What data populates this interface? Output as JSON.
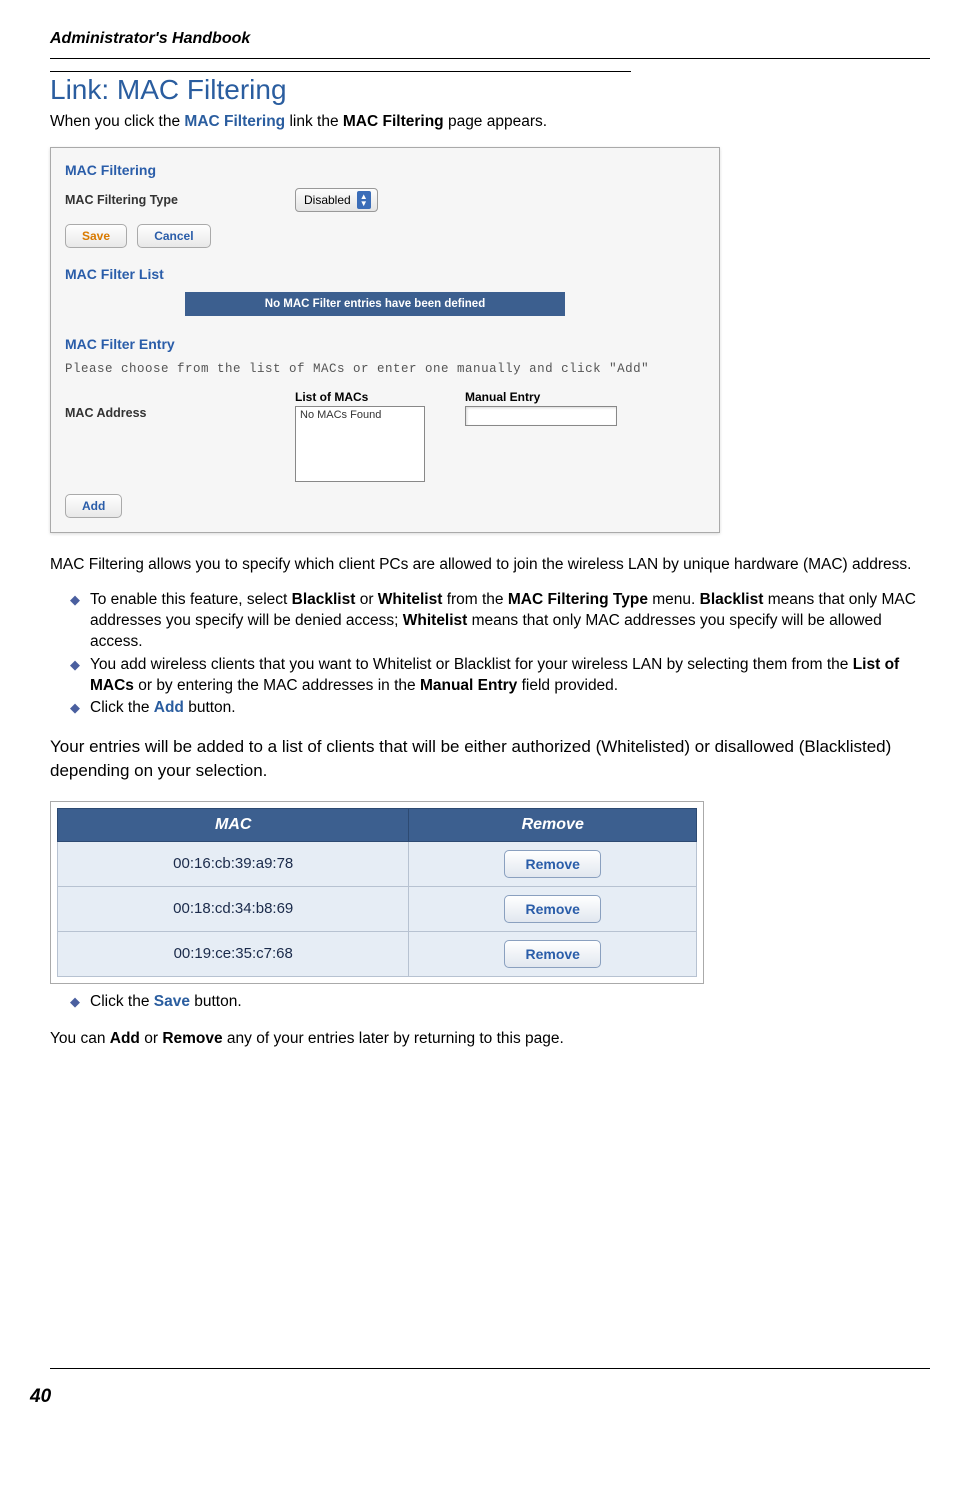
{
  "header": {
    "running": "Administrator's Handbook"
  },
  "section": {
    "title": "Link: MAC Filtering",
    "intro_pre": "When you click the ",
    "intro_link": "MAC Filtering",
    "intro_mid": " link the ",
    "intro_bold": "MAC Filtering",
    "intro_post": " page appears."
  },
  "panel1": {
    "title1": "MAC Filtering",
    "type_label": "MAC Filtering Type",
    "type_value": "Disabled",
    "save": "Save",
    "cancel": "Cancel",
    "title2": "MAC Filter List",
    "empty_msg": "No MAC Filter entries have been defined",
    "title3": "MAC Filter Entry",
    "choose_text": "Please choose from the list of MACs or enter one manually and click \"Add\"",
    "mac_addr_label": "MAC Address",
    "list_label": "List of MACs",
    "list_empty": "No MACs Found",
    "manual_label": "Manual Entry",
    "add": "Add"
  },
  "para1": "MAC Filtering allows you to specify which client PCs are allowed to join the wireless LAN by unique hardware (MAC) address.",
  "bullets1": {
    "b1_pre": "To enable this feature, select ",
    "b1_b1": "Blacklist",
    "b1_or": " or ",
    "b1_b2": "Whitelist",
    "b1_from": " from the ",
    "b1_b3": "MAC Filtering Type",
    "b1_menu": " menu. ",
    "b1_b4": "Blacklist",
    "b1_means1": " means that only MAC addresses you specify will be denied access; ",
    "b1_b5": "Whitelist",
    "b1_means2": " means that only MAC addresses you specify will be allowed access.",
    "b2_pre": "You add wireless clients that you want to Whitelist or Blacklist for your wireless LAN by selecting them from the ",
    "b2_b1": "List of MACs",
    "b2_mid": " or by entering the MAC addresses in the ",
    "b2_b2": "Manual Entry",
    "b2_post": " field provided.",
    "b3_pre": "Click the ",
    "b3_link": "Add",
    "b3_post": " button."
  },
  "para2": "Your entries will be added to a list of clients that will be either authorized (Whitelisted) or disallowed (Blacklisted) depending on your selection.",
  "table": {
    "col1": "MAC",
    "col2": "Remove",
    "rows": [
      {
        "mac": "00:16:cb:39:a9:78",
        "btn": "Remove"
      },
      {
        "mac": "00:18:cd:34:b8:69",
        "btn": "Remove"
      },
      {
        "mac": "00:19:ce:35:c7:68",
        "btn": "Remove"
      }
    ]
  },
  "bullets2": {
    "b1_pre": "Click the ",
    "b1_link": "Save",
    "b1_post": " button."
  },
  "para3_pre": "You can ",
  "para3_b1": "Add",
  "para3_mid": " or ",
  "para3_b2": "Remove",
  "para3_post": " any of your entries later by returning to this page.",
  "page_num": "40"
}
